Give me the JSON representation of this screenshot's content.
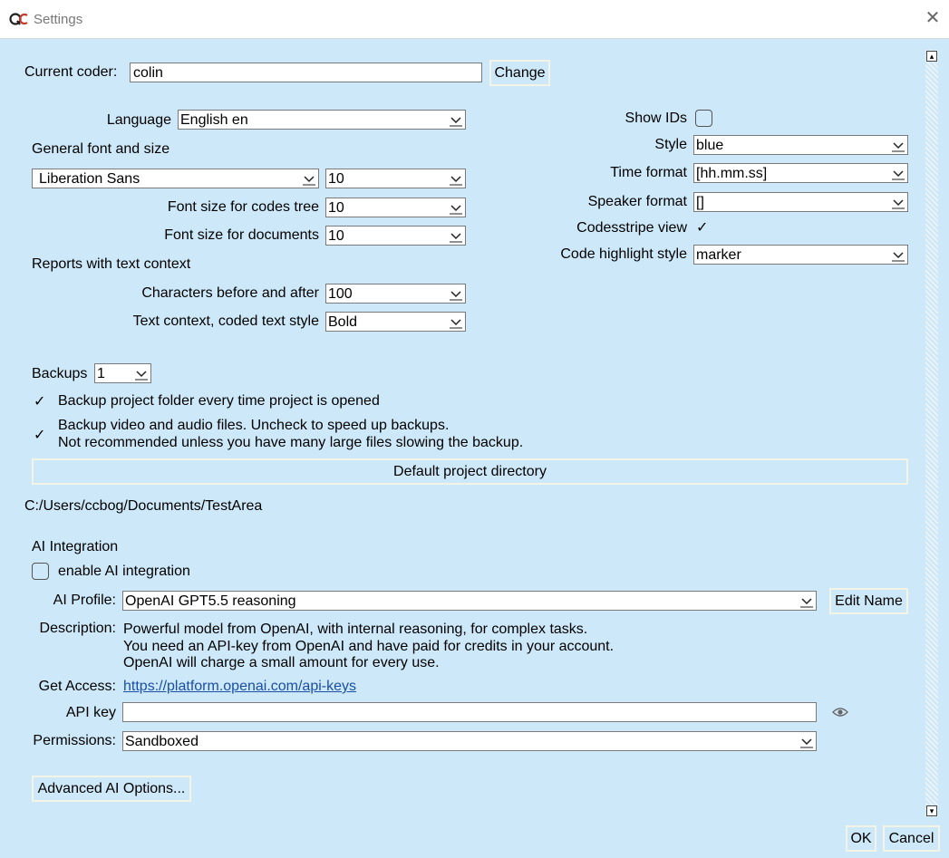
{
  "window": {
    "title": "Settings",
    "icon_text": "QC"
  },
  "coder": {
    "label": "Current coder:",
    "value": "colin",
    "change_label": "Change"
  },
  "left": {
    "language_label": "Language",
    "language_value": "English en",
    "general_font_heading": "General font and size",
    "font_family_value": "Liberation Sans",
    "font_size_value": "10",
    "codes_tree_label": "Font size for codes tree",
    "codes_tree_value": "10",
    "documents_label": "Font size for documents",
    "documents_value": "10",
    "reports_heading": "Reports with text context",
    "chars_label": "Characters before and after",
    "chars_value": "100",
    "coded_style_label": "Text context, coded text style",
    "coded_style_value": "Bold"
  },
  "right": {
    "show_ids_label": "Show IDs",
    "show_ids_checked": false,
    "style_label": "Style",
    "style_value": "blue",
    "time_format_label": "Time format",
    "time_format_value": "[hh.mm.ss]",
    "speaker_format_label": "Speaker format",
    "speaker_format_value": "[]",
    "codestripe_label": "Codesstripe view",
    "codestripe_checked": true,
    "highlight_label": "Code highlight style",
    "highlight_value": "marker"
  },
  "backups": {
    "label": "Backups",
    "value": "1",
    "opt1_label": "Backup project folder every time project is opened",
    "opt2_line1": "Backup video and audio files. Uncheck to speed up backups.",
    "opt2_line2": "Not recommended unless you have many large files slowing the backup.",
    "default_dir_label": "Default project directory",
    "path": "C:/Users/ccbog/Documents/TestArea"
  },
  "ai": {
    "heading": "AI Integration",
    "enable_label": "enable AI integration",
    "enable_checked": false,
    "profile_label": "AI Profile:",
    "profile_value": "OpenAI GPT5.5 reasoning",
    "edit_name_label": "Edit Name",
    "description_label": "Description:",
    "desc_line1": "Powerful model from OpenAI, with internal reasoning, for complex tasks.",
    "desc_line2": "You need an API-key from OpenAI and have paid for credits in your account.",
    "desc_line3": "OpenAI will charge a small amount for every use.",
    "access_label": "Get Access:",
    "access_link": "https://platform.openai.com/api-keys",
    "api_key_label": "API key",
    "api_key_value": "",
    "permissions_label": "Permissions:",
    "permissions_value": "Sandboxed",
    "advanced_label": "Advanced AI Options..."
  },
  "footer": {
    "ok_label": "OK",
    "cancel_label": "Cancel"
  },
  "icons": {
    "app": "qc-app-icon",
    "close": "close-icon",
    "dropdown": "chevron-down-icon",
    "check": "checkmark-icon",
    "eye": "eye-icon"
  }
}
